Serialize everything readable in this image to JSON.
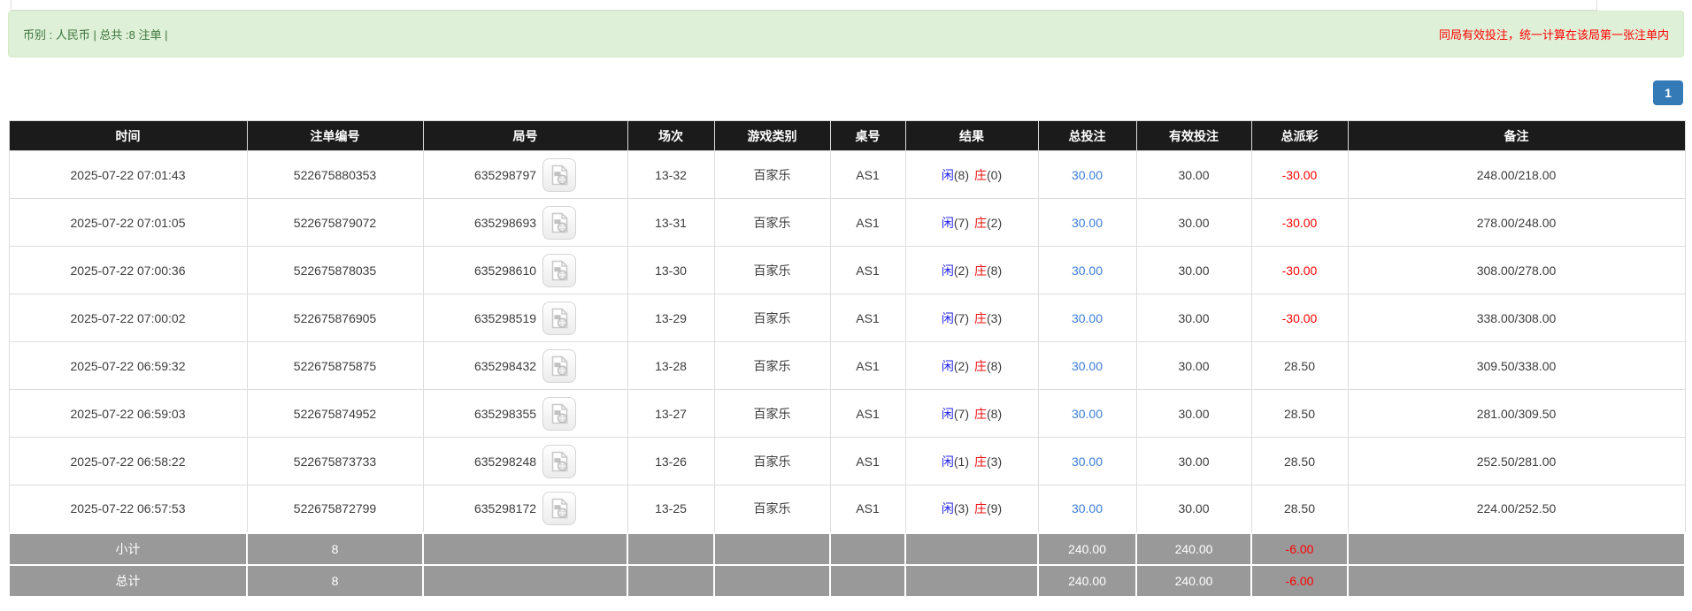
{
  "banner": {
    "left": "币别 : 人民币 | 总共 :8 注单 |",
    "right": "同局有效投注，统一计算在该局第一张注单内"
  },
  "pagination": {
    "current_page": "1"
  },
  "table": {
    "headers": [
      "时间",
      "注单编号",
      "局号",
      "场次",
      "游戏类别",
      "桌号",
      "结果",
      "总投注",
      "有效投注",
      "总派彩",
      "备注"
    ],
    "rows": [
      {
        "time": "2025-07-22 07:01:43",
        "bet_id": "522675880353",
        "round_id": "635298797",
        "session": "13-32",
        "game_type": "百家乐",
        "table_no": "AS1",
        "result": {
          "player_label": "闲",
          "player_score": "(8)",
          "banker_label": "庄",
          "banker_score": "(0)"
        },
        "total_bet": "30.00",
        "valid_bet": "30.00",
        "payout": "-30.00",
        "remark": "248.00/218.00"
      },
      {
        "time": "2025-07-22 07:01:05",
        "bet_id": "522675879072",
        "round_id": "635298693",
        "session": "13-31",
        "game_type": "百家乐",
        "table_no": "AS1",
        "result": {
          "player_label": "闲",
          "player_score": "(7)",
          "banker_label": "庄",
          "banker_score": "(2)"
        },
        "total_bet": "30.00",
        "valid_bet": "30.00",
        "payout": "-30.00",
        "remark": "278.00/248.00"
      },
      {
        "time": "2025-07-22 07:00:36",
        "bet_id": "522675878035",
        "round_id": "635298610",
        "session": "13-30",
        "game_type": "百家乐",
        "table_no": "AS1",
        "result": {
          "player_label": "闲",
          "player_score": "(2)",
          "banker_label": "庄",
          "banker_score": "(8)"
        },
        "total_bet": "30.00",
        "valid_bet": "30.00",
        "payout": "-30.00",
        "remark": "308.00/278.00"
      },
      {
        "time": "2025-07-22 07:00:02",
        "bet_id": "522675876905",
        "round_id": "635298519",
        "session": "13-29",
        "game_type": "百家乐",
        "table_no": "AS1",
        "result": {
          "player_label": "闲",
          "player_score": "(7)",
          "banker_label": "庄",
          "banker_score": "(3)"
        },
        "total_bet": "30.00",
        "valid_bet": "30.00",
        "payout": "-30.00",
        "remark": "338.00/308.00"
      },
      {
        "time": "2025-07-22 06:59:32",
        "bet_id": "522675875875",
        "round_id": "635298432",
        "session": "13-28",
        "game_type": "百家乐",
        "table_no": "AS1",
        "result": {
          "player_label": "闲",
          "player_score": "(2)",
          "banker_label": "庄",
          "banker_score": "(8)"
        },
        "total_bet": "30.00",
        "valid_bet": "30.00",
        "payout": "28.50",
        "remark": "309.50/338.00"
      },
      {
        "time": "2025-07-22 06:59:03",
        "bet_id": "522675874952",
        "round_id": "635298355",
        "session": "13-27",
        "game_type": "百家乐",
        "table_no": "AS1",
        "result": {
          "player_label": "闲",
          "player_score": "(7)",
          "banker_label": "庄",
          "banker_score": "(8)"
        },
        "total_bet": "30.00",
        "valid_bet": "30.00",
        "payout": "28.50",
        "remark": "281.00/309.50"
      },
      {
        "time": "2025-07-22 06:58:22",
        "bet_id": "522675873733",
        "round_id": "635298248",
        "session": "13-26",
        "game_type": "百家乐",
        "table_no": "AS1",
        "result": {
          "player_label": "闲",
          "player_score": "(1)",
          "banker_label": "庄",
          "banker_score": "(3)"
        },
        "total_bet": "30.00",
        "valid_bet": "30.00",
        "payout": "28.50",
        "remark": "252.50/281.00"
      },
      {
        "time": "2025-07-22 06:57:53",
        "bet_id": "522675872799",
        "round_id": "635298172",
        "session": "13-25",
        "game_type": "百家乐",
        "table_no": "AS1",
        "result": {
          "player_label": "闲",
          "player_score": "(3)",
          "banker_label": "庄",
          "banker_score": "(9)"
        },
        "total_bet": "30.00",
        "valid_bet": "30.00",
        "payout": "28.50",
        "remark": "224.00/252.50"
      }
    ],
    "subtotal": {
      "label": "小计",
      "count": "8",
      "total_bet": "240.00",
      "valid_bet": "240.00",
      "payout": "-6.00",
      "remark": ""
    },
    "total": {
      "label": "总计",
      "count": "8",
      "total_bet": "240.00",
      "valid_bet": "240.00",
      "payout": "-6.00",
      "remark": ""
    }
  },
  "icons": {
    "video_replay": "video-replay-icon"
  },
  "colors": {
    "banner_bg": "#dff0d8",
    "banner_border": "#d6e9c6",
    "banner_text_green": "#3c763d",
    "notice_red": "#ff0000",
    "pagination_active_bg": "#337ab7",
    "table_header_bg": "#1b1b1b",
    "player_blue": "#2222ee",
    "banker_red": "#ee1111",
    "bet_link_blue": "#3c7dda",
    "negative_red": "#ff0000",
    "footer_gray": "#999999"
  }
}
